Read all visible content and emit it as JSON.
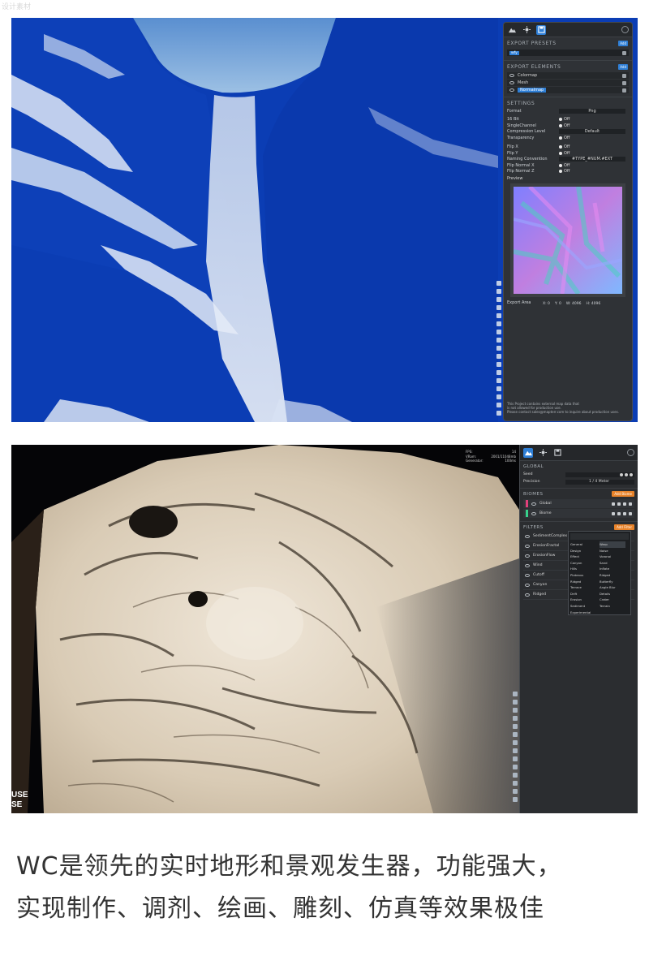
{
  "watermark": "设计素材",
  "shot1": {
    "panel": {
      "tabs": [
        "mountain-icon",
        "sun-icon",
        "save-icon"
      ],
      "presets_head": "EXPORT PRESETS",
      "add_label": "Add",
      "preset_value": "wfy",
      "elements_head": "EXPORT ELEMENTS",
      "elements": [
        "Colormap",
        "Mesh",
        "Normalmap"
      ],
      "settings_head": "SETTINGS",
      "format_label": "Format",
      "format_value": "Png",
      "bit16_label": "16 Bit",
      "bit16_value": "Off",
      "single_label": "SingleChannel",
      "single_value": "Off",
      "compression_label": "Compression Level",
      "compression_value": "Default",
      "transparency_label": "Transparency",
      "transparency_value": "Off",
      "flipx_label": "Flip X",
      "flipx_value": "Off",
      "flipy_label": "Flip Y",
      "flipy_value": "Off",
      "naming_label": "Naming Convention",
      "naming_value": "#TYPE_#NUM.#EXT",
      "flipnx_label": "Flip Normal X",
      "flipnx_value": "Off",
      "flipnz_label": "Flip Normal Z",
      "flipnz_value": "Off",
      "preview_label": "Preview",
      "export_area_label": "Export Area",
      "export_area": [
        "X: 0",
        "Y: 0",
        "W: 4096",
        "H: 4096"
      ],
      "note_lines": [
        "This Project contains external map data that",
        "is not allowed for production use.",
        "Please contact sales@mapterr.com to inquire about production uses."
      ]
    }
  },
  "shot2": {
    "stats": [
      {
        "k": "FPS:",
        "v": "14"
      },
      {
        "k": "VRam:",
        "v": "2001/11048mb"
      },
      {
        "k": "Generator:",
        "v": "100ms"
      }
    ],
    "panel": {
      "global_head": "GLOBAL",
      "seed_label": "Seed",
      "precision_label": "Precision",
      "precision_value": "1 / 4 Meter",
      "biomes_head": "BIOMES",
      "add_biome_label": "Add Biome",
      "biomes": [
        {
          "name": "Global",
          "color": "#e0407a"
        },
        {
          "name": "Biome",
          "color": "#37d08a"
        }
      ],
      "filters_head": "FILTERS",
      "add_filter_label": "Add Filter",
      "filters": [
        "SedimentComplex",
        "ErosionFractal",
        "ErosionFlow",
        "Wind",
        "Cutoff",
        "Canyon",
        "Ridged"
      ],
      "menu_left": [
        "General",
        "Design",
        "Effect",
        "Canyon",
        "Hills",
        "Plateaus",
        "Ridged",
        "Terrace",
        "Drift",
        "Erosion",
        "Sediment",
        "Experimental"
      ],
      "menu_right": [
        "Warp",
        "Noise",
        "Voronoi",
        "Sand",
        "Inflate",
        "Ridged",
        "Butterfly",
        "Angle Blur",
        "Details",
        "Crater",
        "Terrain"
      ]
    },
    "corner_text": [
      "USE",
      "SE"
    ]
  },
  "caption_lines": [
    "WC是领先的实时地形和景观发生器，功能强大，",
    "实现制作、调剂、绘画、雕刻、仿真等效果极佳"
  ]
}
